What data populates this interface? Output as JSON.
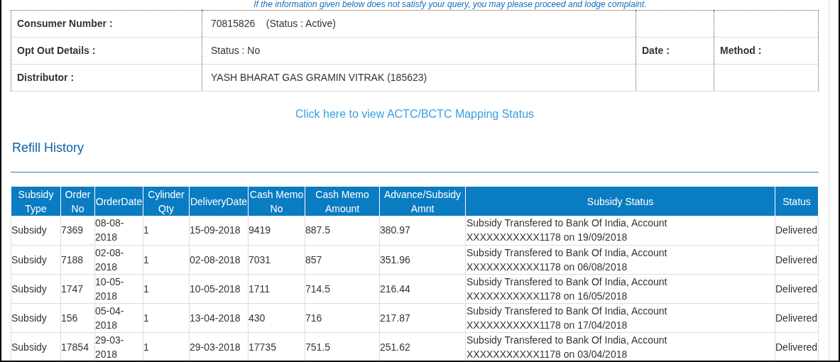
{
  "notice": "If the information given below does not satisfy your query, you may please proceed and lodge complaint.",
  "consumer_details": [
    {
      "label": "Consumer Number :",
      "value": "70815826    (Status : Active)"
    },
    {
      "label": "Opt Out Details :",
      "value": "Status : No",
      "label_2": "Date :",
      "label_3": "Method :"
    },
    {
      "label": "Distributor :",
      "value": "YASH BHARAT GAS GRAMIN VITRAK (185623)"
    }
  ],
  "mapping_link": "Click here to view ACTC/BCTC Mapping Status",
  "section_title": "Refill History",
  "table": {
    "columns": [
      "Subsidy Type",
      "Order No",
      "OrderDate",
      "Cylinder Qty",
      "DeliveryDate",
      "Cash Memo No",
      "Cash Memo Amount",
      "Advance/Subsidy Amnt",
      "Subsidy Status",
      "Status"
    ],
    "rows": [
      [
        "Subsidy",
        "7369",
        "08-08-2018",
        "1",
        "15-09-2018",
        "9419",
        "887.5",
        "380.97",
        "Subsidy Transfered to Bank Of India, Account XXXXXXXXXXX1178 on 19/09/2018",
        "Delivered"
      ],
      [
        "Subsidy",
        "7188",
        "02-08-2018",
        "1",
        "02-08-2018",
        "7031",
        "857",
        "351.96",
        "Subsidy Transfered to Bank Of India, Account XXXXXXXXXXX1178 on 06/08/2018",
        "Delivered"
      ],
      [
        "Subsidy",
        "1747",
        "10-05-2018",
        "1",
        "10-05-2018",
        "1711",
        "714.5",
        "216.44",
        "Subsidy Transfered to Bank Of India, Account XXXXXXXXXXX1178 on 16/05/2018",
        "Delivered"
      ],
      [
        "Subsidy",
        "156",
        "05-04-2018",
        "1",
        "13-04-2018",
        "430",
        "716",
        "217.87",
        "Subsidy Transfered to Bank Of India, Account XXXXXXXXXXX1178 on 17/04/2018",
        "Delivered"
      ],
      [
        "Subsidy",
        "17854",
        "29-03-2018",
        "1",
        "29-03-2018",
        "17735",
        "751.5",
        "251.62",
        "Subsidy Transfered to Bank Of India, Account XXXXXXXXXXX1178 on 03/04/2018",
        "Delivered"
      ]
    ]
  }
}
